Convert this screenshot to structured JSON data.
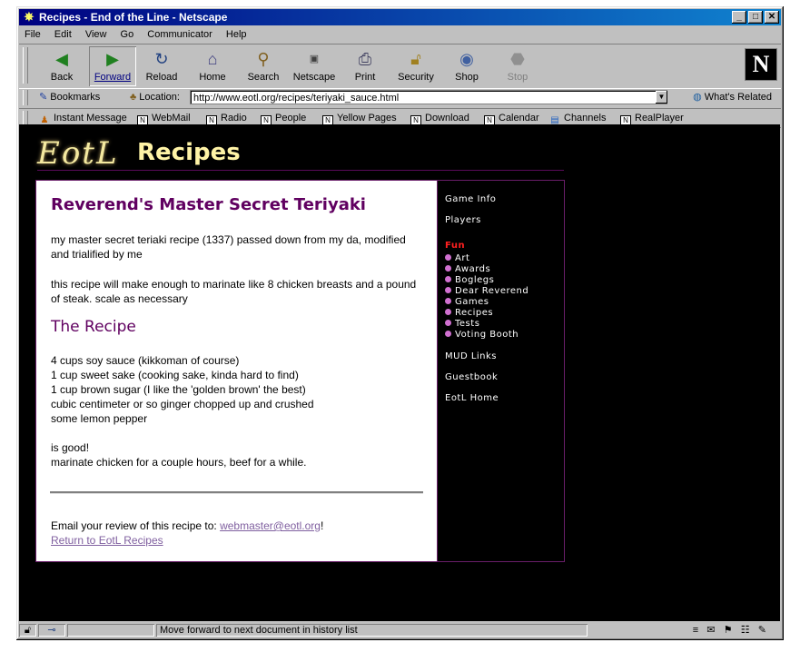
{
  "window": {
    "title": "Recipes - End of the Line - Netscape"
  },
  "menu": [
    "File",
    "Edit",
    "View",
    "Go",
    "Communicator",
    "Help"
  ],
  "toolbar": [
    {
      "label": "Back",
      "icon": "back-arrow-icon"
    },
    {
      "label": "Forward",
      "icon": "forward-arrow-icon"
    },
    {
      "label": "Reload",
      "icon": "reload-icon"
    },
    {
      "label": "Home",
      "icon": "home-icon"
    },
    {
      "label": "Search",
      "icon": "search-icon"
    },
    {
      "label": "Netscape",
      "icon": "netscape-icon"
    },
    {
      "label": "Print",
      "icon": "print-icon"
    },
    {
      "label": "Security",
      "icon": "lock-icon"
    },
    {
      "label": "Shop",
      "icon": "shop-icon"
    },
    {
      "label": "Stop",
      "icon": "stop-icon"
    }
  ],
  "location": {
    "bookmarks": "Bookmarks",
    "label": "Location:",
    "url": "http://www.eotl.org/recipes/teriyaki_sauce.html",
    "related": "What's Related"
  },
  "personal": [
    "Instant Message",
    "WebMail",
    "Radio",
    "People",
    "Yellow Pages",
    "Download",
    "Calendar",
    "Channels",
    "RealPlayer"
  ],
  "page": {
    "logo_left": "EotL",
    "logo_right": "Recipes",
    "title": "Reverend's Master Secret Teriyaki",
    "intro1": "my master secret teriaki recipe (1337) passed down from my da, modified and trialified by me",
    "intro2": "this recipe will make enough to marinate like 8 chicken breasts and a pound of steak. scale as necessary",
    "recipe_heading": "The Recipe",
    "ingredients": [
      "4 cups soy sauce (kikkoman of course)",
      "1 cup sweet sake (cooking sake, kinda hard to find)",
      "1 cup brown sugar (I like the 'golden brown' the best)",
      "cubic centimeter or so ginger chopped up and crushed",
      "some lemon pepper"
    ],
    "closing": [
      "is good!",
      "marinate chicken for a couple hours, beef for a while."
    ],
    "email_text": "Email your review of this recipe to: ",
    "email_link": "webmaster@eotl.org",
    "email_after": "!",
    "back_link": "Return to EotL Recipes"
  },
  "sidebar": {
    "top": [
      "Game Info",
      "Players"
    ],
    "fun_label": "Fun",
    "fun_items": [
      "Art",
      "Awards",
      "Boglegs",
      "Dear Reverend",
      "Games",
      "Recipes",
      "Tests",
      "Voting Booth"
    ],
    "bottom": [
      "MUD Links",
      "Guestbook",
      "EotL Home"
    ]
  },
  "status": {
    "message": "Move forward to next document in history list"
  },
  "colors": {
    "title_purple": "#600060",
    "fun_red": "#ff2020",
    "link": "#8060a0"
  }
}
